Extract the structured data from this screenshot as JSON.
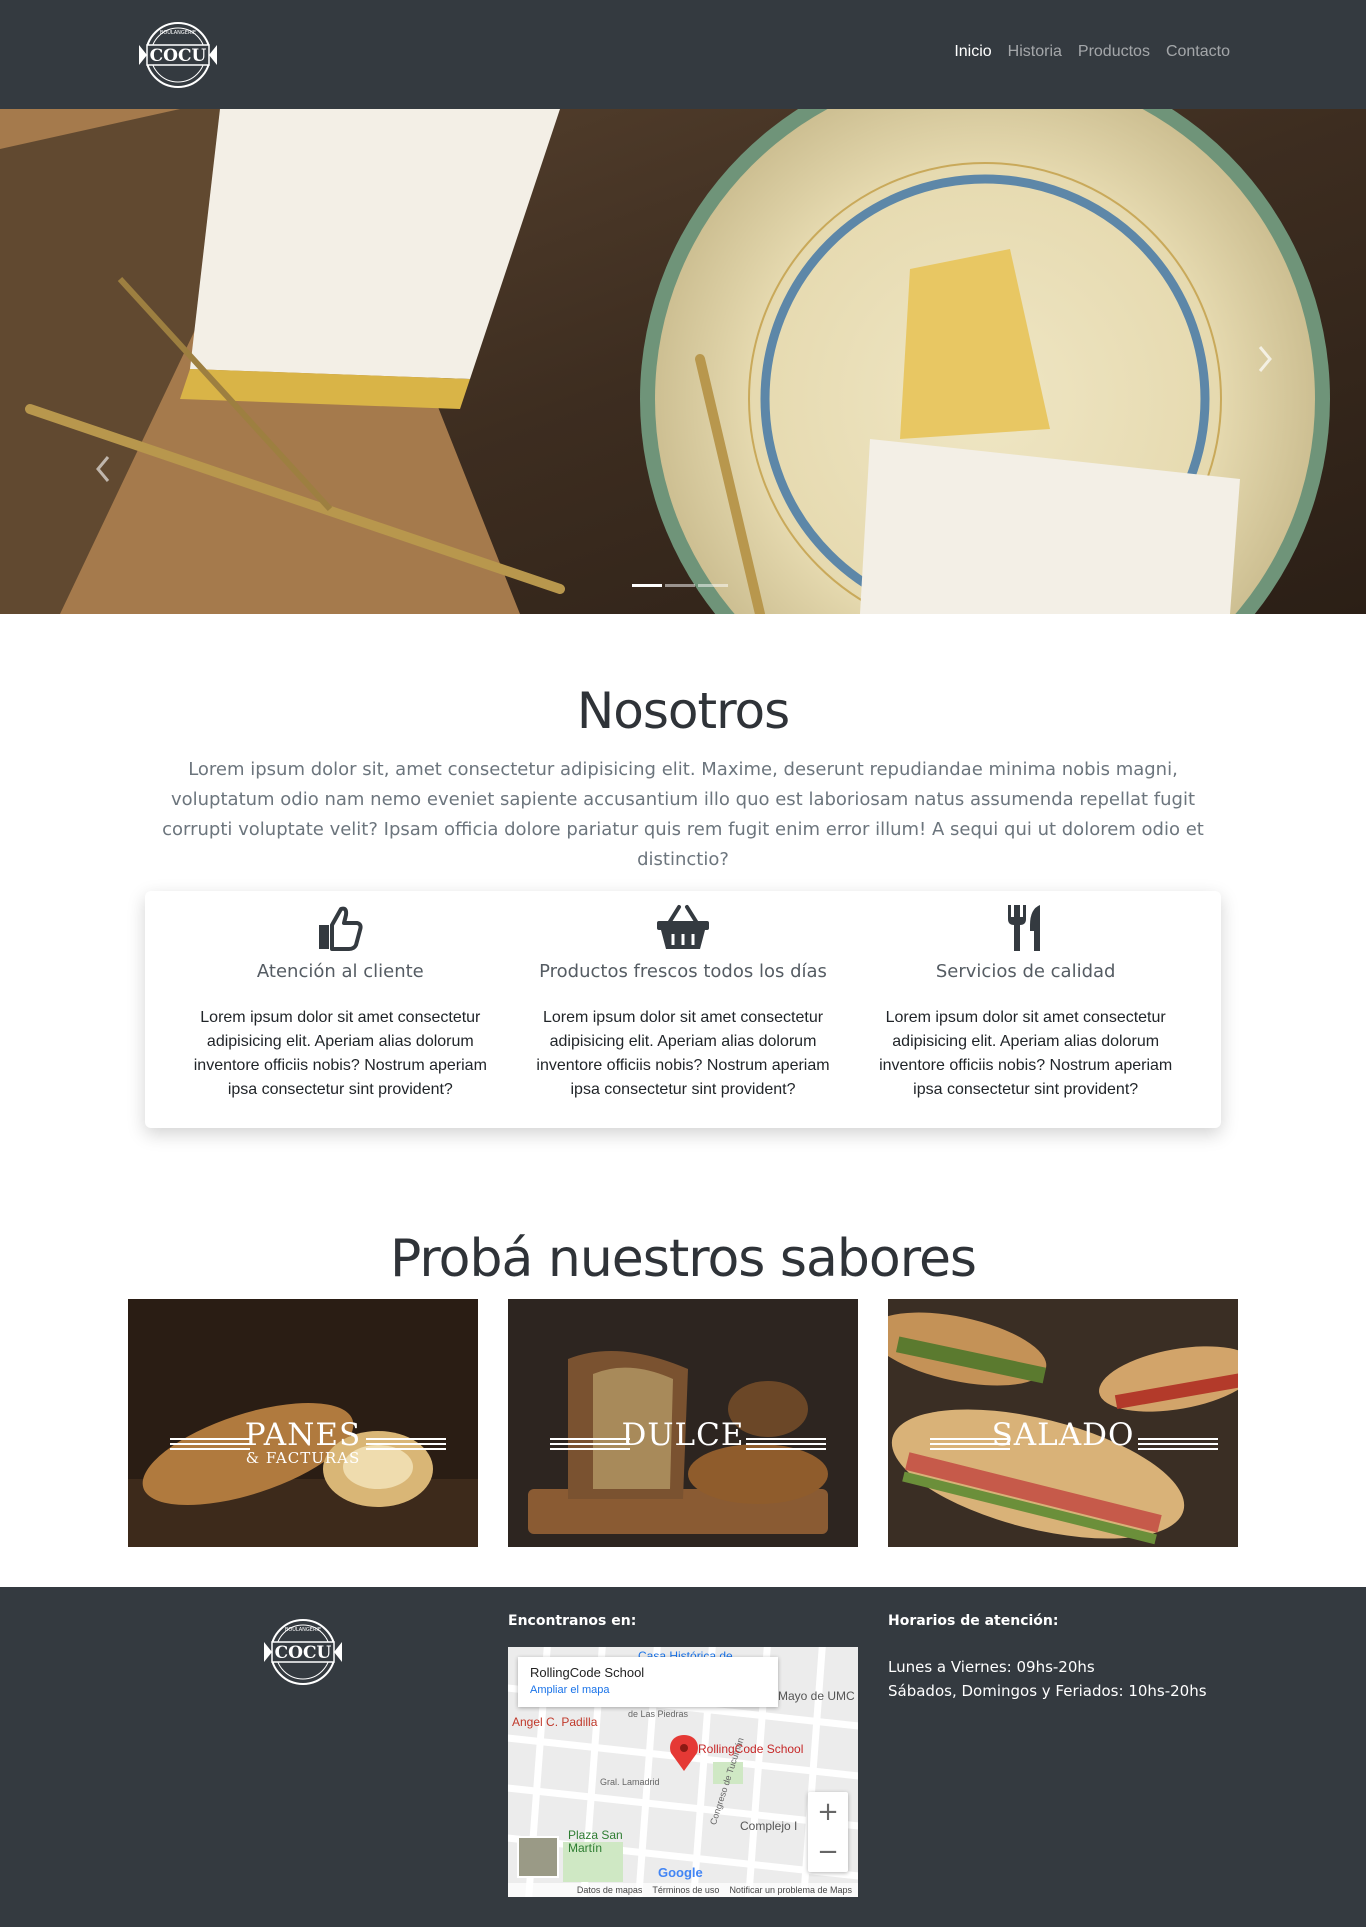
{
  "brand": {
    "logo_text": "COCU",
    "logo_arc_text": "BOULANGERIE"
  },
  "nav": {
    "items": [
      "Inicio",
      "Historia",
      "Productos",
      "Contacto"
    ],
    "active_index": 0
  },
  "carousel": {
    "slide_count": 3,
    "active_slide": 0
  },
  "nosotros": {
    "title": "Nosotros",
    "text": "Lorem ipsum dolor sit, amet consectetur adipisicing elit. Maxime, deserunt repudiandae minima nobis magni, voluptatum odio nam nemo eveniet sapiente accusantium illo quo est laboriosam natus assumenda repellat fugit corrupti voluptate velit? Ipsam officia dolore pariatur quis rem fugit enim error illum! A sequi qui ut dolorem odio et distinctio?"
  },
  "features": [
    {
      "icon": "thumbs-up-icon",
      "title": "Atención al cliente",
      "text": "Lorem ipsum dolor sit amet consectetur adipisicing elit. Aperiam alias dolorum inventore officiis nobis? Nostrum aperiam ipsa consectetur sint provident?"
    },
    {
      "icon": "basket-icon",
      "title": "Productos frescos todos los días",
      "text": "Lorem ipsum dolor sit amet consectetur adipisicing elit. Aperiam alias dolorum inventore officiis nobis? Nostrum aperiam ipsa consectetur sint provident?"
    },
    {
      "icon": "utensils-icon",
      "title": "Servicios de calidad",
      "text": "Lorem ipsum dolor sit amet consectetur adipisicing elit. Aperiam alias dolorum inventore officiis nobis? Nostrum aperiam ipsa consectetur sint provident?"
    }
  ],
  "sabores": {
    "title": "Probá nuestros sabores",
    "categories": [
      {
        "label": "PANES",
        "sub": "& FACTURAS"
      },
      {
        "label": "DULCE",
        "sub": ""
      },
      {
        "label": "SALADO",
        "sub": ""
      }
    ]
  },
  "footer": {
    "map_heading": "Encontranos en:",
    "hours_heading": "Horarios de atención:",
    "hours": [
      "Lunes a Viernes: 09hs-20hs",
      "Sábados, Domingos y Feriados: 10hs-20hs"
    ],
    "map": {
      "place": "RollingCode School",
      "enlarge": "Ampliar el mapa",
      "pin_label": "RollingCode School",
      "labels": [
        "Casa Histórica de",
        "Mayo de UMC",
        "Angel C. Padilla",
        "Gral. Lamadrid",
        "Complejo I",
        "Plaza San Martín",
        "de Las Piedras",
        "Congreso de Tucumán"
      ],
      "google": "Google",
      "footer_links": [
        "Datos de mapas",
        "Términos de uso",
        "Notificar un problema de Maps"
      ]
    }
  },
  "colors": {
    "dark": "#343a40",
    "white": "#ffffff"
  }
}
